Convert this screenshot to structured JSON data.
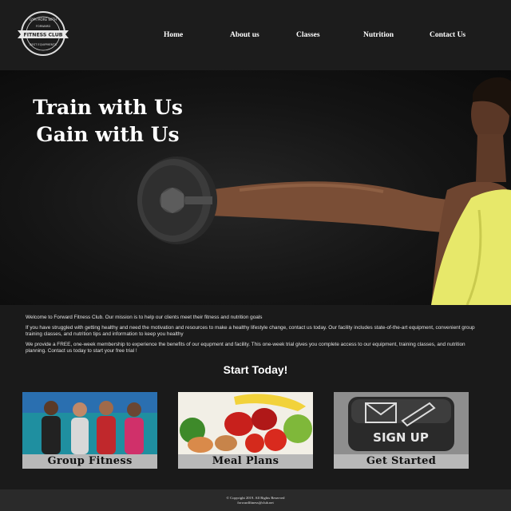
{
  "logo": {
    "top_text": "GYM MORE WITH",
    "middle_text": "FORWARD",
    "main_text": "FITNESS CLUB",
    "bottom_text": "BEST EQUIPMENTS"
  },
  "nav": {
    "items": [
      "Home",
      "About us",
      "Classes",
      "Nutrition",
      "Contact Us"
    ]
  },
  "hero": {
    "line1": "Train with Us",
    "line2": "Gain with Us"
  },
  "intro": {
    "p1": "Welcome to Forward Fitness Club. Our mission is to help our clients meet their fitness and nutrition goals",
    "p2": "If you have struggled with getting healthy and need the motivation and resources to make a healthy lifestyle change, contact us today. Our facility includes state-of-the-art equipment, convenient group training classes, and nutrition tips and information to keep you healthy",
    "p3": "We provide a FREE, one-week membership to experience the benefits of our equpment and facility. This one-week trial gives you complete access to our equipment, training classes, and nutrition planning. Contact us today to start your free trial !"
  },
  "cta_heading": "Start Today!",
  "cards": [
    {
      "label": "Group Fitness"
    },
    {
      "label": "Meal Plans"
    },
    {
      "label": "Get Started",
      "image_text": "SIGN UP"
    }
  ],
  "footer": {
    "copyright": "© Copyright 2019. All Rights Reserved",
    "email": "forwardfitness@club.net"
  },
  "colors": {
    "background": "#1a1a1a",
    "header": "#1c1c1c",
    "footer": "#2a2a2a",
    "label_bar": "#b8b8b8",
    "shirt": "#e7e86a"
  }
}
